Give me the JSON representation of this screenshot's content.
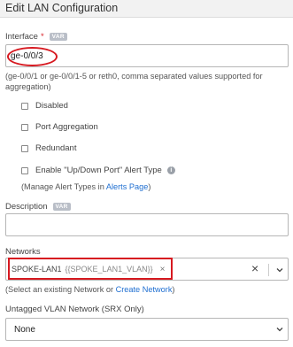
{
  "header": {
    "title": "Edit LAN Configuration"
  },
  "interface": {
    "label": "Interface",
    "required_mark": "*",
    "badge": "VAR",
    "value": "ge-0/0/3",
    "help": "(ge-0/0/1 or ge-0/0/1-5 or reth0, comma separated values supported for aggregation)"
  },
  "options": {
    "disabled": "Disabled",
    "port_aggregation": "Port Aggregation",
    "redundant": "Redundant",
    "updown_alert": "Enable \"Up/Down Port\" Alert Type"
  },
  "manage": {
    "prefix": "(Manage Alert Types in ",
    "link": "Alerts Page",
    "suffix": ")"
  },
  "description": {
    "label": "Description",
    "badge": "VAR",
    "value": ""
  },
  "networks": {
    "label": "Networks",
    "tag_name": "SPOKE-LAN1",
    "tag_var": "{{SPOKE_LAN1_VLAN}}",
    "tag_remove": "×",
    "clear": "×",
    "help_prefix": "(Select an existing Network or ",
    "help_link": "Create Network",
    "help_suffix": ")"
  },
  "untagged": {
    "label": "Untagged VLAN Network (SRX Only)",
    "value": "None"
  },
  "icons": {
    "info": "info-icon",
    "chevron": "chevron-down-icon",
    "close": "close-icon"
  },
  "colors": {
    "highlight": "#d71920",
    "link": "#1f6fd1",
    "required": "#d9262c"
  }
}
